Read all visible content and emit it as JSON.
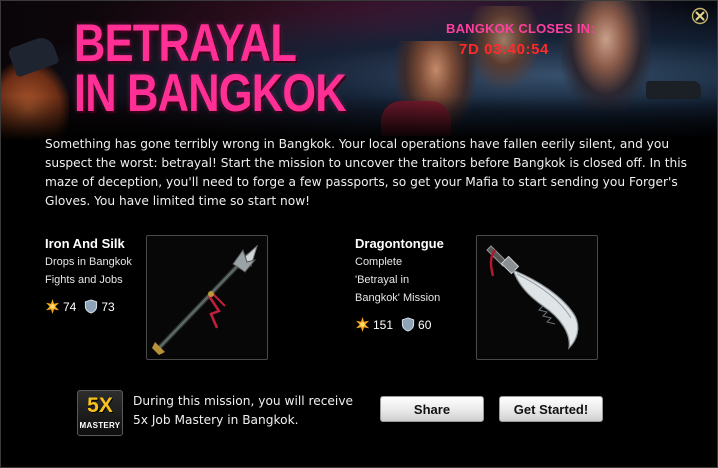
{
  "event": {
    "title_line1": "BETRAYAL",
    "title_line2": "IN BANGKOK",
    "timer_label": "BANGKOK CLOSES IN:",
    "timer_value": "7D 03:40:54",
    "description": "Something has gone terribly wrong in Bangkok. Your local operations have fallen eerily silent, and you suspect the worst: betrayal! Start the mission to uncover the traitors before Bangkok is closed off. In this maze of deception, you'll need to forge a few passports, so get your Mafia to start sending you Forger's Gloves. You have limited time so start now!"
  },
  "rewards": [
    {
      "name": "Iron And Silk",
      "desc_line1": "Drops in Bangkok",
      "desc_line2": "Fights and Jobs",
      "attack": "74",
      "defense": "73",
      "icon": "spear-weapon-icon"
    },
    {
      "name": "Dragontongue",
      "desc_line1": "Complete",
      "desc_line2": "'Betrayal in",
      "desc_line3": "Bangkok' Mission",
      "attack": "151",
      "defense": "60",
      "icon": "curved-blade-weapon-icon"
    }
  ],
  "mastery": {
    "multiplier": "5X",
    "word": "MASTERY",
    "text_line1": "During this mission, you will receive",
    "text_line2": "5x Job Mastery in Bangkok."
  },
  "buttons": {
    "share": "Share",
    "start": "Get Started!"
  },
  "colors": {
    "title": "#ff2f95",
    "timer_label": "#ff3fa0",
    "timer_value": "#ff2a2a",
    "attack_icon": "#f5a623",
    "defense_icon": "#7c8fa6",
    "mastery_multiplier": "#f7c21a"
  },
  "icons": {
    "close": "close-x-icon",
    "attack": "attack-burst-icon",
    "defense": "defense-shield-icon"
  }
}
